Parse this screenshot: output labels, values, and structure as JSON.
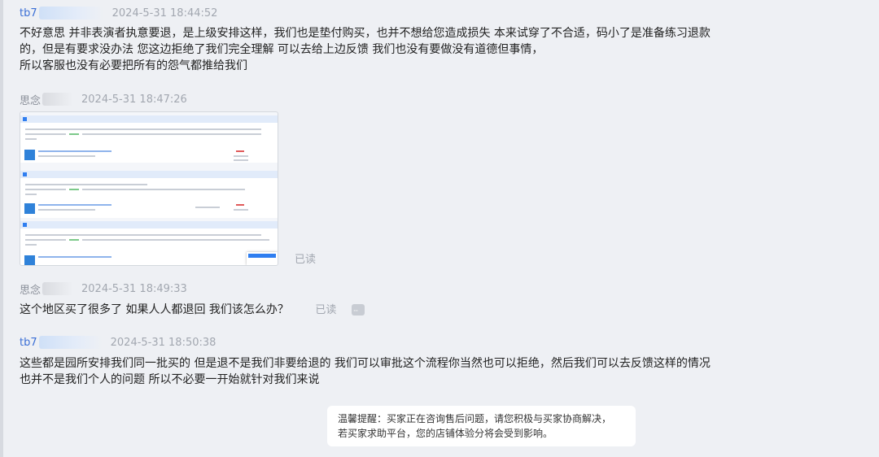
{
  "messages": [
    {
      "name": "tb7",
      "time": "2024-5-31 18:44:52",
      "lines": [
        "不好意思  并非表演者执意要退，是上级安排这样，我们也是垫付购买，也并不想给您造成损失   本来试穿了不合适，码小了是准备练习退款",
        "的，但是有要求没办法   您这边拒绝了我们完全理解  可以去给上边反馈   我们也没有要做没有道德但事情，",
        "所以客服也没有必要把所有的怨气都推给我们"
      ]
    },
    {
      "name": "思念",
      "time": "2024-5-31 18:47:26",
      "status": "已读"
    },
    {
      "name": "思念",
      "time": "2024-5-31 18:49:33",
      "lines": [
        "这个地区买了很多了  如果人人都退回  我们该怎么办？"
      ],
      "status": "已读"
    },
    {
      "name": "tb7",
      "time": "2024-5-31 18:50:38",
      "lines": [
        "这些都是园所安排我们同一批买的    但是退不是我们非要给退的  我们可以审批这个流程你当然也可以拒绝，然后我们可以去反馈这样的情况",
        "也并不是我们个人的问题  所以不必要一开始就针对我们来说"
      ]
    }
  ],
  "notice": {
    "line1": "温馨提醒：买家正在咨询售后问题，请您积极与买家协商解决，",
    "line2": "若买家求助平台，您的店铺体验分将会受到影响。"
  },
  "colors": {
    "background": "#eef0f4",
    "seller_name": "#3b6fd6",
    "buyer_name": "#8a8f99",
    "timestamp": "#a2a7b0"
  },
  "icons": {
    "more": "more-options-icon"
  }
}
